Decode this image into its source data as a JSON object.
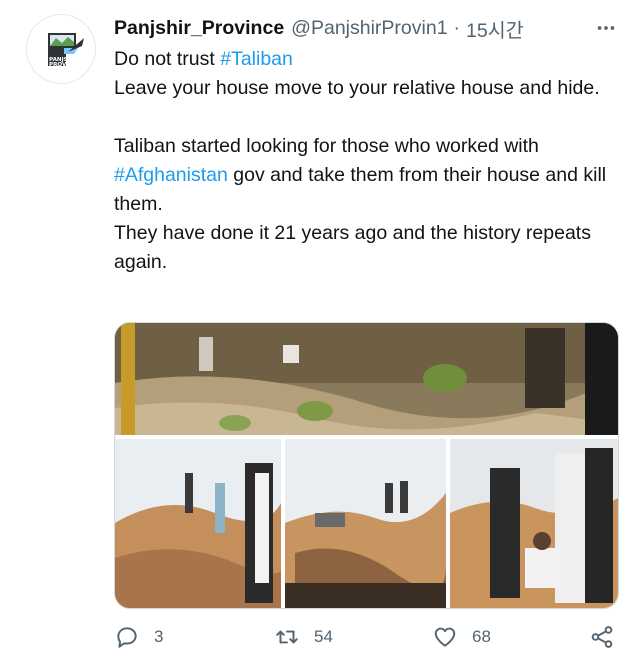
{
  "account": {
    "display_name": "Panjshir_Province",
    "handle": "@PanjshirProvin1",
    "separator": "·",
    "time": "15시간",
    "avatar_text_line1": "PANJSHIR",
    "avatar_text_line2": "PROVINCE"
  },
  "tweet": {
    "line1_prefix": "Do not trust ",
    "line1_hashtag": "#Taliban",
    "line2": "Leave your house move to your relative house and hide.",
    "para2_prefix": "Taliban started looking for those who worked with ",
    "para2_hashtag": "#Afghanistan",
    "para2_suffix": " gov and take them from their house and kill them.",
    "line_last": "They have done it 21 years ago and the history repeats again."
  },
  "media": {
    "image_count": 4
  },
  "actions": {
    "reply_count": "3",
    "retweet_count": "54",
    "like_count": "68"
  },
  "colors": {
    "hashtag": "#1d9bf0",
    "secondary_text": "#536471",
    "primary_text": "#0f1419",
    "border": "#cfd9de"
  },
  "icons": [
    "more-icon",
    "reply-icon",
    "retweet-icon",
    "like-icon",
    "share-icon"
  ]
}
